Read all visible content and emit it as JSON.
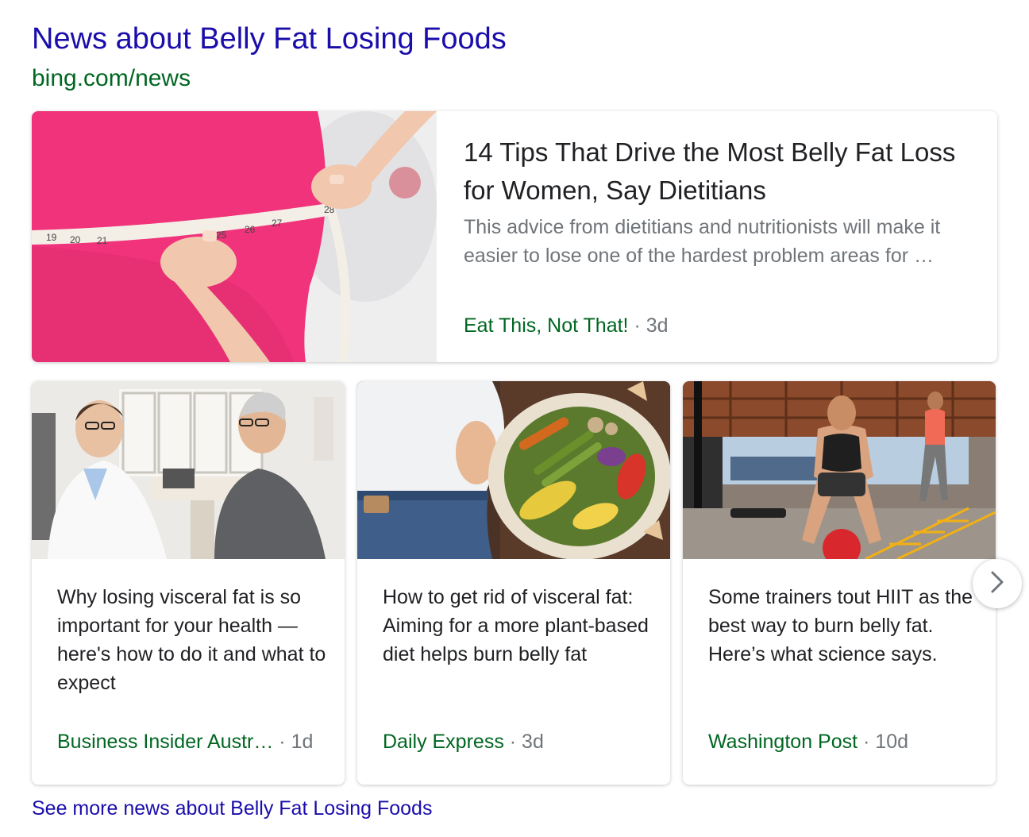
{
  "header": {
    "title": "News about Belly Fat Losing Foods",
    "url": "bing.com/news"
  },
  "featured": {
    "title": "14 Tips That Drive the Most Belly Fat Loss for Women, Say Dietitians",
    "snippet": "This advice from dietitians and nutritionists will make it easier to lose one of the hardest problem areas for …",
    "source": "Eat This, Not That!",
    "age": "· 3d",
    "tape_numbers": [
      "19",
      "20",
      "21",
      "25",
      "26",
      "27",
      "28"
    ]
  },
  "cards": [
    {
      "title": "Why losing visceral fat is so important for your health — here's how to do it and what to expect",
      "source": "Business Insider Austr…",
      "age": "· 1d"
    },
    {
      "title": "How to get rid of visceral fat: Aiming for a more plant-based diet helps burn belly fat",
      "source": "Daily Express",
      "age": "· 3d"
    },
    {
      "title": "Some trainers tout HIIT as the best way to burn belly fat. Here’s what science says.",
      "source": "Washington Post",
      "age": "· 10d"
    }
  ],
  "more_link": "See more news about Belly Fat Losing Foods",
  "icons": {
    "next": "chevron-right-icon"
  },
  "colors": {
    "link": "#1a0dab",
    "url": "#006621",
    "source": "#006621",
    "muted": "#70757a",
    "text": "#202124"
  }
}
